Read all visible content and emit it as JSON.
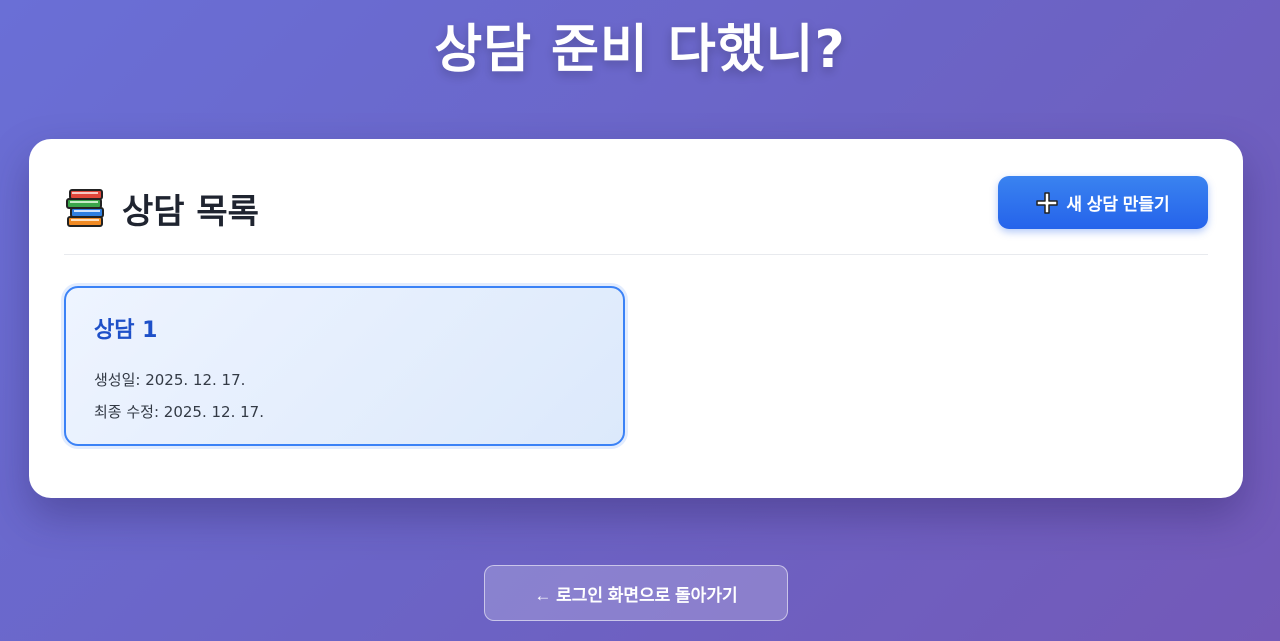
{
  "page": {
    "title": "상담 준비 다했니?"
  },
  "panel": {
    "section_title": "상담 목록",
    "section_icon": "books-icon",
    "new_button_icon": "plus-icon",
    "new_button_label": "새 상담 만들기"
  },
  "sessions": [
    {
      "title": "상담 1",
      "created": "생성일: 2025. 12. 17.",
      "modified": "최종 수정: 2025. 12. 17."
    }
  ],
  "footer": {
    "back_button_label": "← 로그인 화면으로 돌아가기"
  },
  "colors": {
    "accent": "#2563eb",
    "card_title": "#1e50c8",
    "background_start": "#6a6fd6",
    "background_end": "#7359b8"
  }
}
